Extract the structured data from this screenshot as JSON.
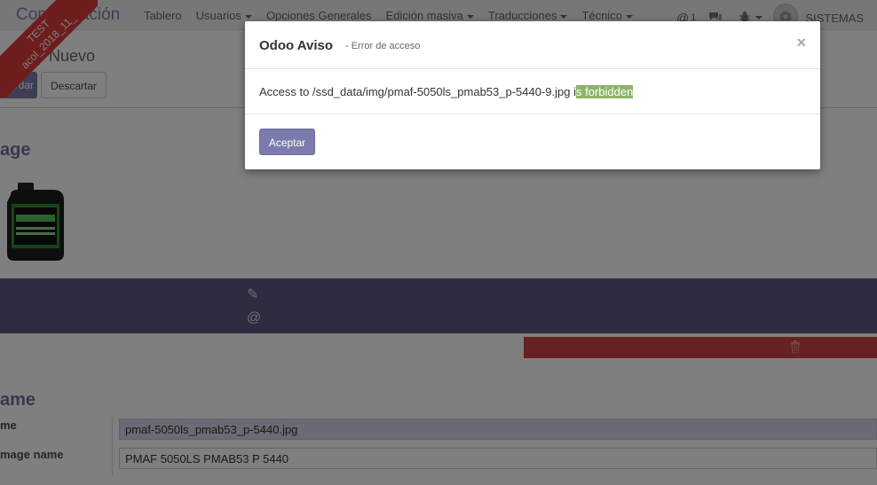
{
  "navbar": {
    "app_title": "Configuración",
    "menu": [
      {
        "label": "Tablero",
        "caret": false
      },
      {
        "label": "Usuarios",
        "caret": true
      },
      {
        "label": "Opciones Generales",
        "caret": false
      },
      {
        "label": "Edición masiva",
        "caret": true
      },
      {
        "label": "Traducciones",
        "caret": true
      },
      {
        "label": "Técnico",
        "caret": true
      }
    ],
    "mentions_count": "1",
    "user_name": "SISTEMAS"
  },
  "ribbon": {
    "line1": "TEST",
    "line2": "acol_2018_11_"
  },
  "control": {
    "breadcrumb_parent": "e /",
    "breadcrumb_current": "Nuevo",
    "save_label": "uardar",
    "discard_label": "Descartar"
  },
  "form": {
    "image_heading": "age",
    "name_heading": "ame",
    "field1_label": "me",
    "field1_value": "pmaf-5050ls_pmab53_p-5440.jpg",
    "field2_label": "mage name",
    "field2_value": "PMAF 5050LS PMAB53 P 5440"
  },
  "dialog": {
    "title": "Odoo Aviso",
    "subtitle": "- Error de acceso",
    "close_glyph": "×",
    "message_prefix": "Access to /ssd_data/img/pmaf-5050ls_pmab53_p-5440-9.jpg i",
    "message_highlight": "s forbidden",
    "ok_label": "Aceptar"
  },
  "colors": {
    "brand": "#7c7bad",
    "danger": "#cc4444",
    "highlight": "#8db56a"
  }
}
